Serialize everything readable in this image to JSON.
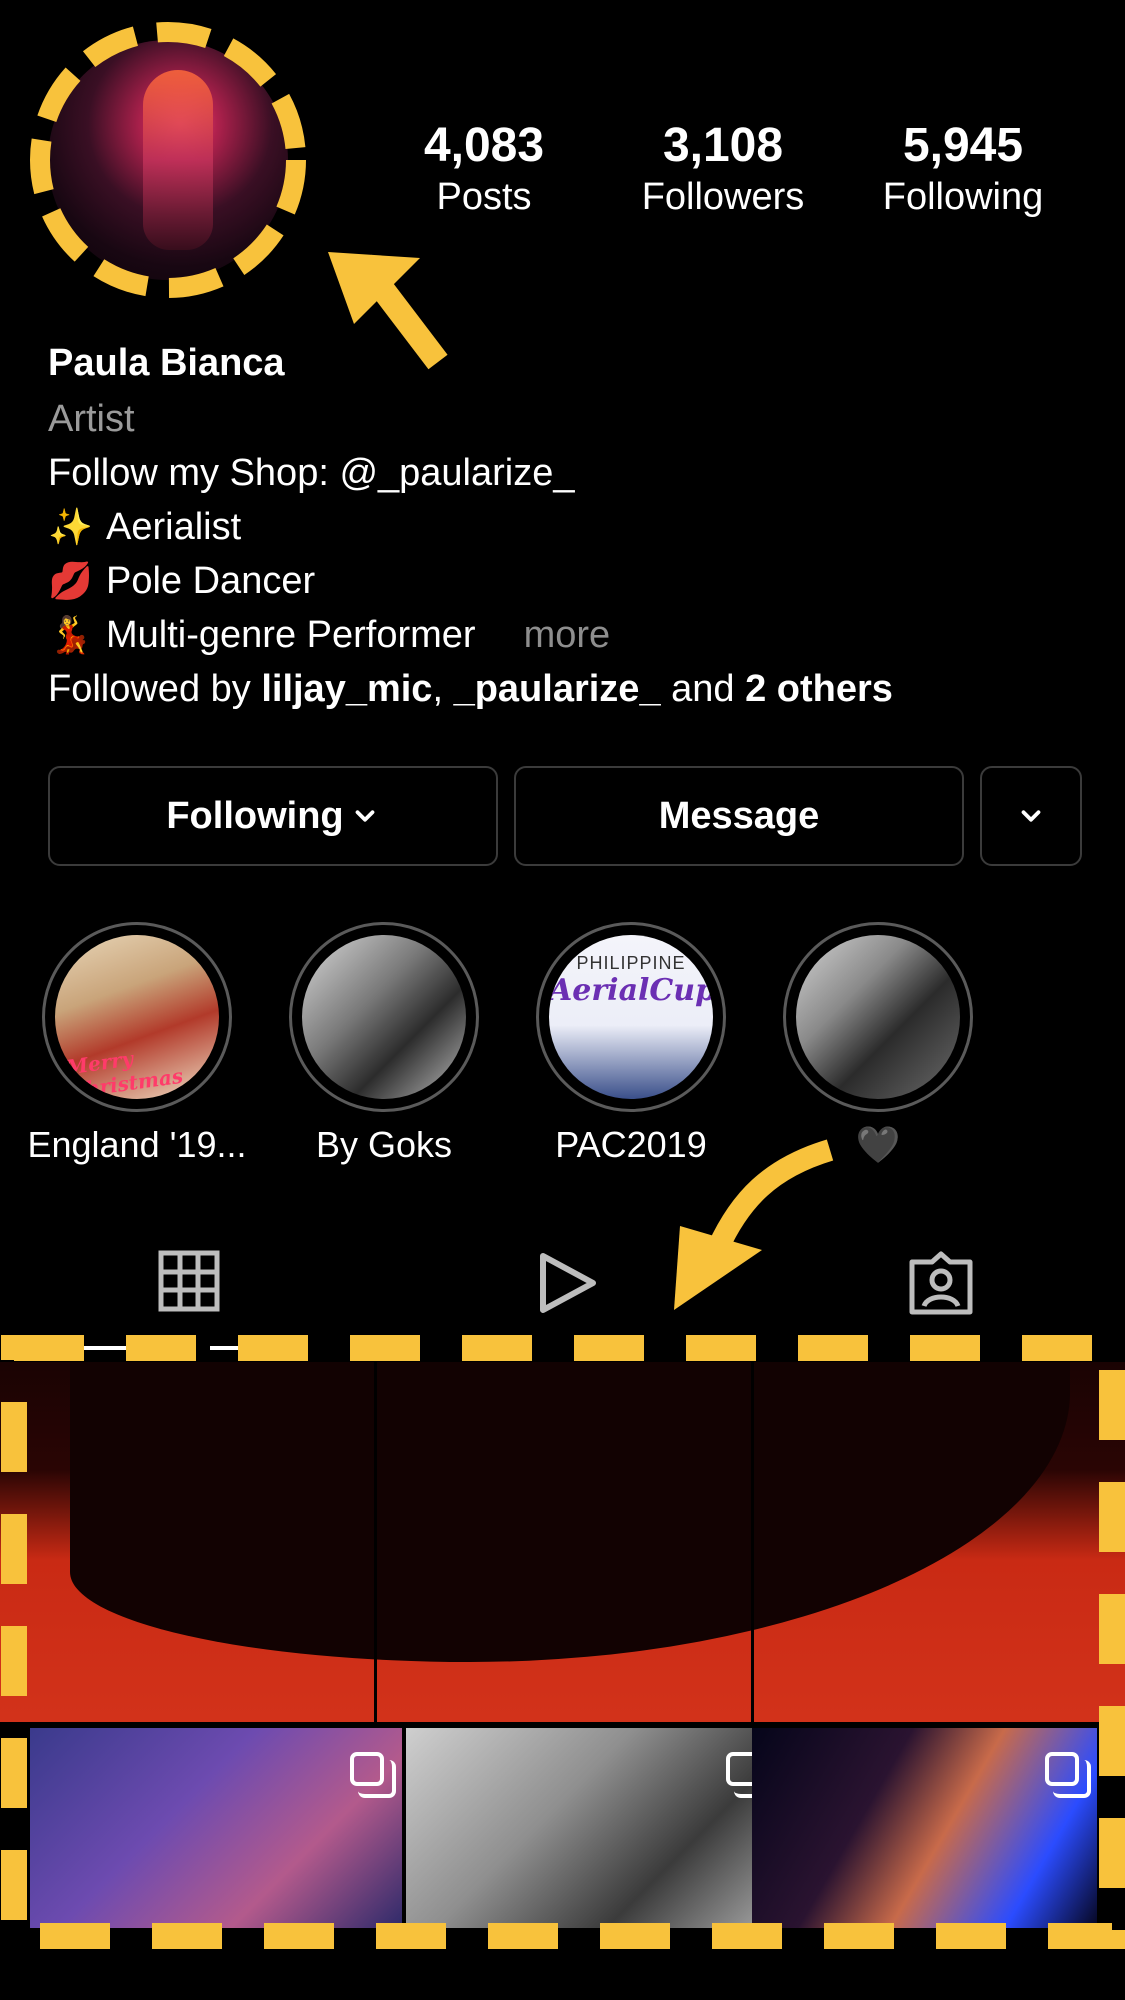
{
  "profile": {
    "name": "Paula Bianca",
    "category": "Artist",
    "bio_line1": "Follow my Shop: @_paularize_",
    "bio_items": [
      {
        "emoji": "✨",
        "text": "Aerialist"
      },
      {
        "emoji": "💋",
        "text": "Pole Dancer"
      },
      {
        "emoji": "💃",
        "text": "Multi-genre Performer"
      }
    ],
    "more_label": "more",
    "followed_by_prefix": "Followed by ",
    "followed_by_user1": "liljay_mic",
    "followed_by_sep": ", ",
    "followed_by_user2": "_paularize_",
    "followed_by_and": " and ",
    "followed_by_others": "2 others"
  },
  "stats": {
    "posts": {
      "value": "4,083",
      "label": "Posts"
    },
    "followers": {
      "value": "3,108",
      "label": "Followers"
    },
    "following": {
      "value": "5,945",
      "label": "Following"
    }
  },
  "buttons": {
    "following": "Following",
    "message": "Message"
  },
  "highlights": [
    {
      "label": "England '19..."
    },
    {
      "label": "By Goks"
    },
    {
      "label": "PAC2019"
    },
    {
      "label": "🖤"
    }
  ],
  "highlight_texts": {
    "pac_line1": "PHILIPPINE",
    "pac_line2": "AerialCup",
    "england_caption": "Merry Christmas"
  },
  "tabs": [
    {
      "icon": "grid-icon"
    },
    {
      "icon": "reels-play-icon"
    },
    {
      "icon": "tagged-person-icon"
    }
  ],
  "colors": {
    "annotation": "#F8C23C",
    "background": "#000000",
    "button_border": "#3b3b3b"
  }
}
